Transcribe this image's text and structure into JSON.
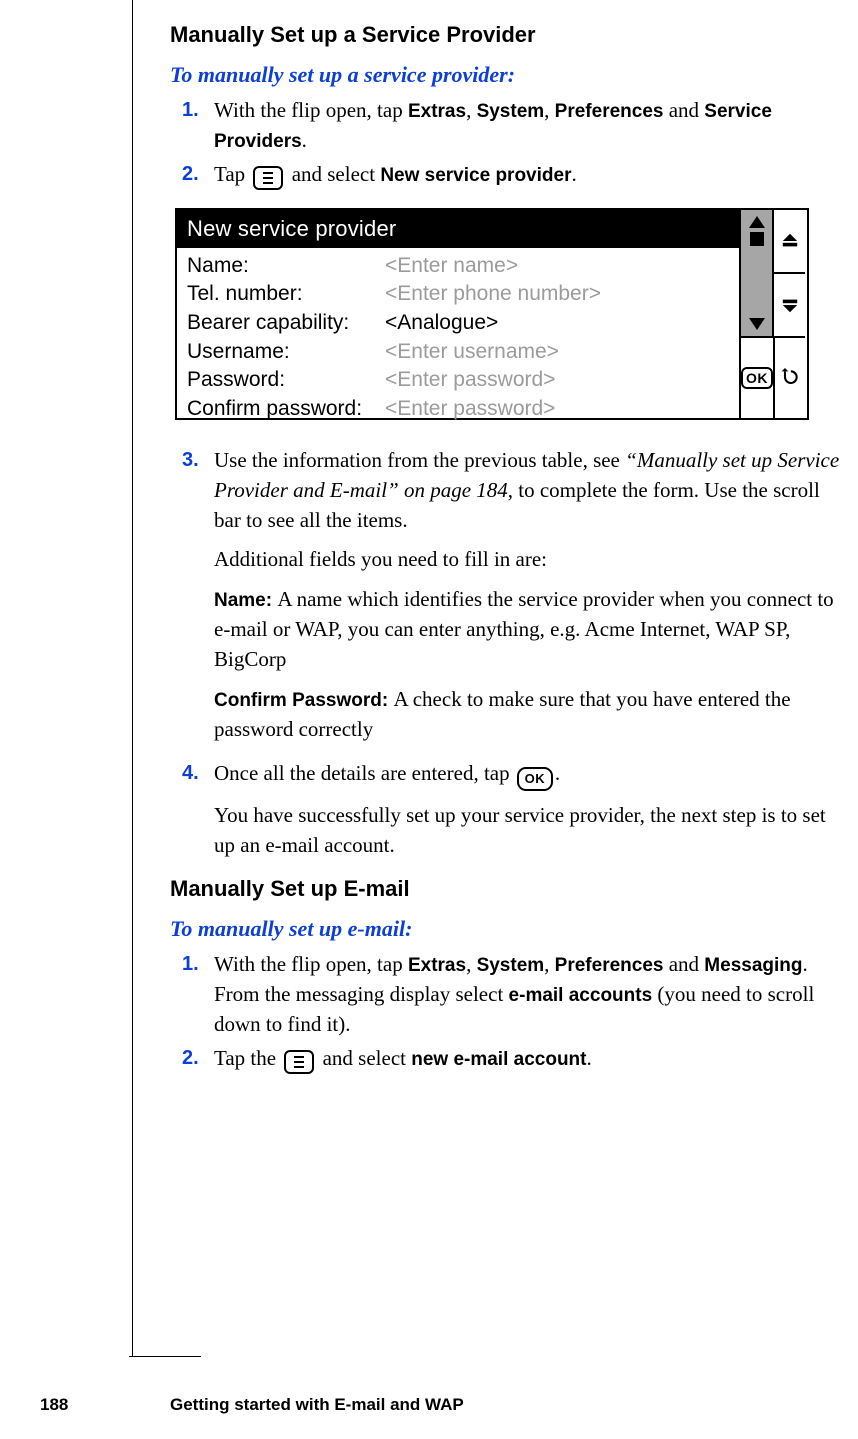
{
  "section1_title": "Manually Set up a Service Provider",
  "task1": "To manually set up a service provider:",
  "sp_steps": {
    "s1_a": "With the flip open, tap ",
    "s1_extras": "Extras",
    "s1_c1": ", ",
    "s1_system": "System",
    "s1_c2": ", ",
    "s1_prefs": "Preferences",
    "s1_and": " and ",
    "s1_sp": "Service Providers",
    "s1_dot": ".",
    "s2_a": "Tap ",
    "s2_b": " and select ",
    "s2_new": "New service provider",
    "s2_dot": ".",
    "s3_a": "Use the information from the previous table, see ",
    "s3_ref": "“Manually set up Service Provider and E-mail” on page 184",
    "s3_b": ", to complete the form. Use the scroll bar to see all the items.",
    "s3_c": "Additional fields you need to fill in are:",
    "s3_name_lbl": "Name: ",
    "s3_name_txt": "A name which identifies the service provider when you connect to e-mail or WAP, you can enter anything, e.g. Acme Internet, WAP SP, BigCorp",
    "s3_conf_lbl": "Confirm Password: ",
    "s3_conf_txt": "A check to make sure that you have entered the password correctly",
    "s4_a": "Once all the details are entered, tap ",
    "s4_dot": ".",
    "s4_b": "You have successfully set up your service provider, the next step is to set up an e-mail account."
  },
  "device": {
    "title": "New service provider",
    "rows": [
      {
        "lbl": "Name:",
        "val": "<Enter name>",
        "ph": true
      },
      {
        "lbl": "Tel. number:",
        "val": "<Enter phone number>",
        "ph": true
      },
      {
        "lbl": "Bearer capability:",
        "val": "<Analogue>",
        "ph": false
      },
      {
        "lbl": "Username:",
        "val": "<Enter username>",
        "ph": true
      },
      {
        "lbl": "Password:",
        "val": "<Enter password>",
        "ph": true
      },
      {
        "lbl": "Confirm password:",
        "val": "<Enter password>",
        "ph": true
      }
    ],
    "ok_label": "OK"
  },
  "section2_title": "Manually Set up E-mail",
  "task2": "To manually set up e-mail:",
  "em_steps": {
    "s1_a": "With the flip open, tap ",
    "s1_extras": "Extras",
    "s1_c1": ", ",
    "s1_system": "System",
    "s1_c2": ", ",
    "s1_prefs": "Preferences",
    "s1_and": " and ",
    "s1_msg": "Messaging",
    "s1_b": ". From the messaging display select ",
    "s1_acc": "e-mail accounts",
    "s1_c": " (you need to scroll down to find it).",
    "s2_a": "Tap the ",
    "s2_b": " and select ",
    "s2_new": "new e-mail account",
    "s2_dot": "."
  },
  "footer": {
    "page": "188",
    "chapter": "Getting started with E-mail and WAP"
  }
}
